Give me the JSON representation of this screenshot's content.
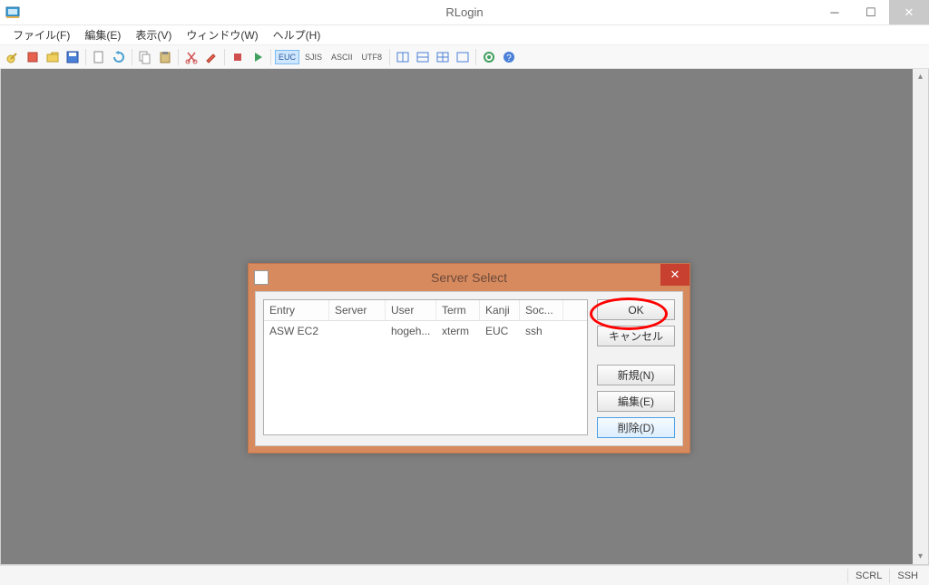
{
  "window": {
    "title": "RLogin"
  },
  "menu": {
    "file": "ファイル(F)",
    "edit": "編集(E)",
    "view": "表示(V)",
    "window": "ウィンドウ(W)",
    "help": "ヘルプ(H)"
  },
  "toolbar": {
    "enc1": "EUC",
    "enc2": "SJIS",
    "enc3": "ASCII",
    "enc4": "UTF8"
  },
  "status": {
    "scrl": "SCRL",
    "ssh": "SSH"
  },
  "dialog": {
    "title": "Server Select",
    "columns": {
      "entry": "Entry",
      "server": "Server",
      "user": "User",
      "term": "Term",
      "kanji": "Kanji",
      "soc": "Soc..."
    },
    "rows": [
      {
        "entry": "ASW EC2",
        "server": "",
        "user": "hogeh...",
        "term": "xterm",
        "kanji": "EUC",
        "soc": "ssh"
      }
    ],
    "buttons": {
      "ok": "OK",
      "cancel": "キャンセル",
      "new": "新規(N)",
      "edit": "編集(E)",
      "delete": "削除(D)"
    }
  }
}
